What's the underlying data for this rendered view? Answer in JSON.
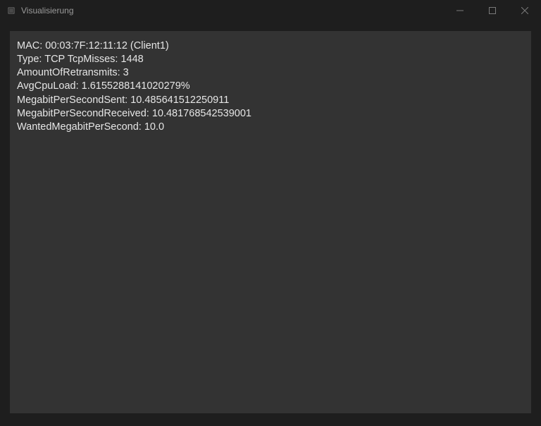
{
  "window": {
    "title": "Visualisierung"
  },
  "stats": {
    "line1": "MAC: 00:03:7F:12:11:12 (Client1)",
    "line2": "Type: TCP TcpMisses: 1448",
    "line3": "AmountOfRetransmits: 3",
    "line4": "AvgCpuLoad: 1.6155288141020279%",
    "line5": "MegabitPerSecondSent: 10.485641512250911",
    "line6": "MegabitPerSecondReceived: 10.481768542539001",
    "line7": "WantedMegabitPerSecond: 10.0"
  }
}
